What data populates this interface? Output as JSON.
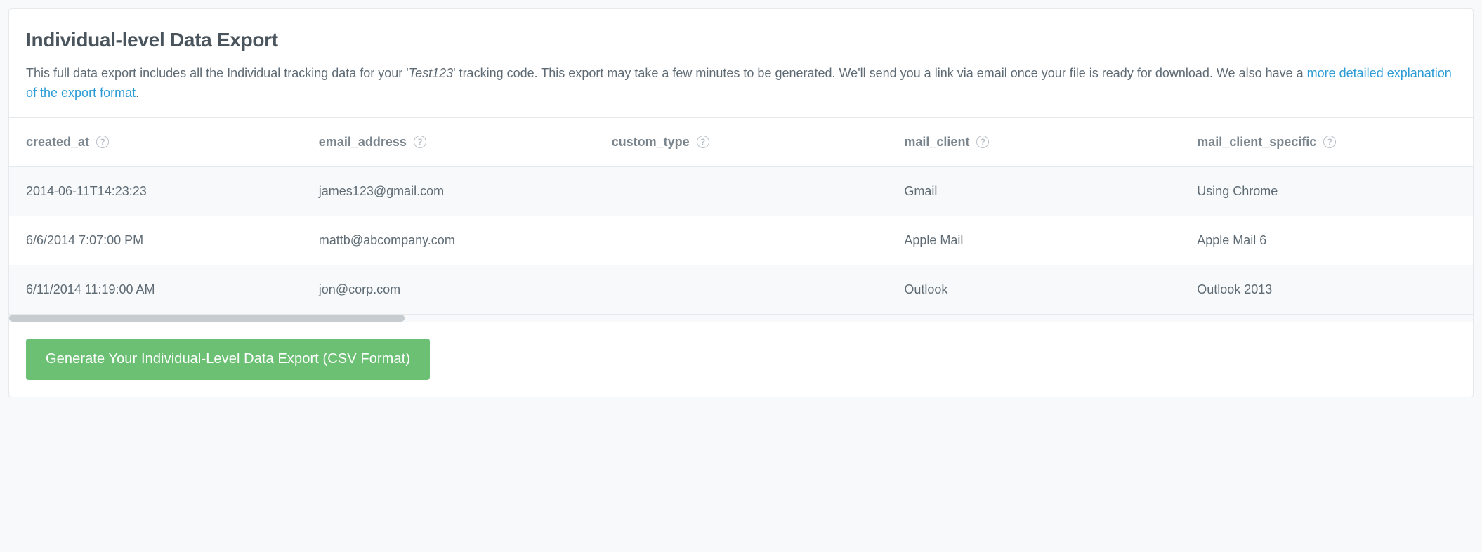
{
  "header": {
    "title": "Individual-level Data Export",
    "desc_prefix": "This full data export includes all the Individual tracking data for your '",
    "tracking_code": "Test123",
    "desc_mid": "' tracking code. This export may take a few minutes to be generated. We'll send you a link via email once your file is ready for download. We also have a ",
    "link_text": "more detailed explanation of the export format",
    "desc_suffix": "."
  },
  "table": {
    "columns": [
      {
        "key": "created_at",
        "label": "created_at"
      },
      {
        "key": "email_address",
        "label": "email_address"
      },
      {
        "key": "custom_type",
        "label": "custom_type"
      },
      {
        "key": "mail_client",
        "label": "mail_client"
      },
      {
        "key": "mail_client_specific",
        "label": "mail_client_specific"
      }
    ],
    "rows": [
      {
        "created_at": "2014-06-11T14:23:23",
        "email_address": "james123@gmail.com",
        "custom_type": "",
        "mail_client": "Gmail",
        "mail_client_specific": "Using Chrome"
      },
      {
        "created_at": "6/6/2014 7:07:00 PM",
        "email_address": "mattb@abcompany.com",
        "custom_type": "",
        "mail_client": "Apple Mail",
        "mail_client_specific": "Apple Mail 6"
      },
      {
        "created_at": "6/11/2014 11:19:00 AM",
        "email_address": "jon@corp.com",
        "custom_type": "",
        "mail_client": "Outlook",
        "mail_client_specific": "Outlook 2013"
      }
    ]
  },
  "footer": {
    "button_label": "Generate Your Individual-Level Data Export (CSV Format)"
  }
}
